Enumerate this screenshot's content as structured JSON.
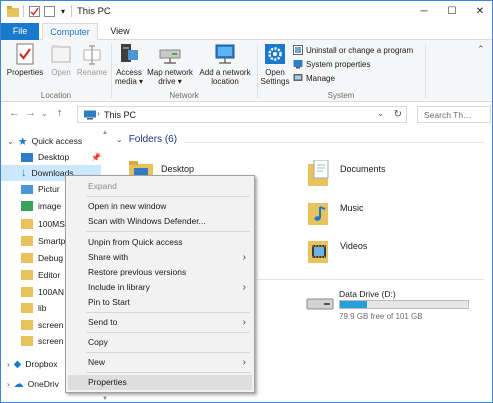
{
  "window": {
    "title": "This PC",
    "controls": {
      "minimize": "─",
      "maximize": "☐",
      "close": "✕"
    }
  },
  "ribbon": {
    "tabs": [
      {
        "label": "File"
      },
      {
        "label": "Computer"
      },
      {
        "label": "View"
      }
    ],
    "location": {
      "group_label": "Location",
      "properties": "Properties",
      "open": "Open",
      "rename": "Rename"
    },
    "network": {
      "group_label": "Network",
      "access_media": "Access media ▾",
      "map_drive": "Map network drive ▾",
      "add_location": "Add a network location"
    },
    "system": {
      "group_label": "System",
      "open_settings": "Open Settings",
      "uninstall": "Uninstall or change a program",
      "system_properties": "System properties",
      "manage": "Manage"
    }
  },
  "address": {
    "path": "This PC",
    "search_placeholder": "Search Th…"
  },
  "nav": {
    "items": [
      {
        "label": "Quick access"
      },
      {
        "label": "Desktop"
      },
      {
        "label": "Downloads"
      },
      {
        "label": "Pictur"
      },
      {
        "label": "image"
      },
      {
        "label": "100MS"
      },
      {
        "label": "Smartp"
      },
      {
        "label": "Debug"
      },
      {
        "label": "Editor"
      },
      {
        "label": "100AN"
      },
      {
        "label": "lib"
      },
      {
        "label": "screen"
      },
      {
        "label": "screen"
      },
      {
        "label": "Dropbox"
      },
      {
        "label": "OneDriv"
      }
    ]
  },
  "content": {
    "folders_heading": "Folders (6)",
    "folders": [
      {
        "label": "Desktop"
      },
      {
        "label": "Documents"
      },
      {
        "label": "Music"
      },
      {
        "label": "Videos"
      }
    ],
    "drive": {
      "name": "Data Drive (D:)",
      "free_text": "79.9 GB free of 101 GB",
      "used_fraction": 0.21
    }
  },
  "context_menu": {
    "expand": "Expand",
    "open_new_window": "Open in new window",
    "scan_defender": "Scan with Windows Defender...",
    "unpin": "Unpin from Quick access",
    "share_with": "Share with",
    "restore_versions": "Restore previous versions",
    "include_library": "Include in library",
    "pin_start": "Pin to Start",
    "send_to": "Send to",
    "copy": "Copy",
    "new": "New",
    "properties": "Properties",
    "submenu_arrow": "›"
  },
  "colors": {
    "accent": "#1979ca",
    "folder": "#e8c25c",
    "drive_fill": "#26a0da",
    "selection": "#cce8ff"
  }
}
